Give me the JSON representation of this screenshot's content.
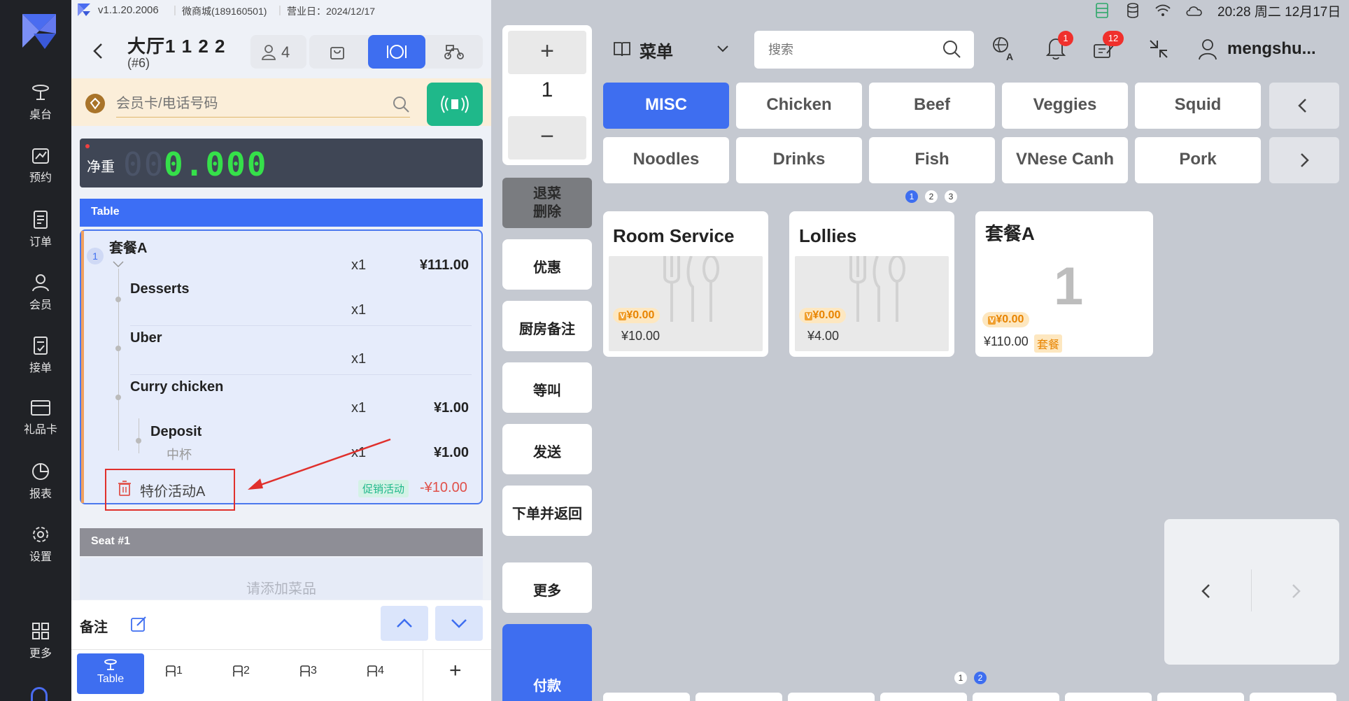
{
  "topbar": {
    "version": "v1.1.20.2006",
    "store": "微商城(189160501)",
    "business_day": "营业日：2024/12/17",
    "clock": "20:28 周二 12月17日"
  },
  "sidebar": {
    "items": [
      {
        "label": "桌台",
        "icon": "table-icon"
      },
      {
        "label": "预约",
        "icon": "reservation-icon"
      },
      {
        "label": "订单",
        "icon": "orders-icon"
      },
      {
        "label": "会员",
        "icon": "member-icon"
      },
      {
        "label": "接单",
        "icon": "accept-order-icon"
      },
      {
        "label": "礼品卡",
        "icon": "gift-card-icon"
      },
      {
        "label": "报表",
        "icon": "report-icon"
      },
      {
        "label": "设置",
        "icon": "settings-icon"
      },
      {
        "label": "更多",
        "icon": "more-grid-icon"
      }
    ]
  },
  "order_header": {
    "table_name": "大厅1 1 2 2",
    "order_no": "(#6)",
    "guests": "4"
  },
  "member": {
    "placeholder": "会员卡/电话号码"
  },
  "scale": {
    "label": "净重",
    "dim_digits": "00",
    "value": "0.000"
  },
  "table_section": {
    "header": "Table",
    "combo_index": "1",
    "combo_name": "套餐A",
    "combo_qty": "x1",
    "combo_price": "¥111.00",
    "items": [
      {
        "name": "Desserts",
        "qty": "x1",
        "price": ""
      },
      {
        "name": "Uber",
        "qty": "x1",
        "price": ""
      },
      {
        "name": "Curry chicken",
        "qty": "x1",
        "price": "¥1.00"
      }
    ],
    "sub_item": {
      "name": "Deposit",
      "spec": "中杯",
      "qty": "x1",
      "price": "¥1.00"
    },
    "promo": {
      "name": "特价活动A",
      "tag": "促销活动",
      "amount": "-¥10.00"
    }
  },
  "seat": {
    "header": "Seat #1",
    "empty_text": "请添加菜品"
  },
  "notes": {
    "label": "备注"
  },
  "seat_tabs": {
    "table_label": "Table",
    "seats": [
      "1",
      "2",
      "3",
      "4"
    ],
    "add": "+"
  },
  "middle": {
    "plus": "+",
    "qty": "1",
    "minus": "−",
    "return_delete": [
      "退菜",
      "删除"
    ],
    "discount": "优惠",
    "kitchen_note": "厨房备注",
    "hold": "等叫",
    "send": "发送",
    "order_return": "下单并返回",
    "more": "更多",
    "pay": "付款"
  },
  "menu_bar": {
    "menu_label": "菜单",
    "search_placeholder": "搜索",
    "notif_count": "1",
    "orders_count": "12",
    "user": "mengshu..."
  },
  "categories": {
    "row1": [
      "MISC",
      "Chicken",
      "Beef",
      "Veggies",
      "Squid"
    ],
    "row2": [
      "Noodles",
      "Drinks",
      "Fish",
      "VNese Canh",
      "Pork"
    ],
    "pages": [
      "1",
      "2",
      "3"
    ]
  },
  "products": [
    {
      "name": "Room Service",
      "member_price": "¥0.00",
      "price": "¥10.00"
    },
    {
      "name": "Lollies",
      "member_price": "¥0.00",
      "price": "¥4.00"
    },
    {
      "name": "套餐A",
      "count": "1",
      "member_price": "¥0.00",
      "price": "¥110.00",
      "tag": "套餐"
    }
  ],
  "product_pages": [
    "1",
    "2"
  ],
  "colors": {
    "accent": "#3e6ef0",
    "sidebar": "#202226",
    "scale_green": "#35e04a",
    "promo_red": "#e0504a",
    "teal": "#1fb88a",
    "badge_red": "#f0302c"
  }
}
